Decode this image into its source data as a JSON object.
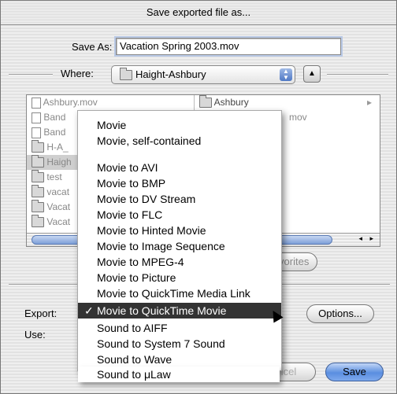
{
  "dialog": {
    "title": "Save exported file as...",
    "save_as_label": "Save As:",
    "save_as_value": "Vacation Spring 2003.mov",
    "where_label": "Where:",
    "where_value": "Haight-Ashbury"
  },
  "browser": {
    "left_column": [
      "Ashbury.mov",
      "Band",
      "Band",
      "H-A_",
      "Haigh",
      "test",
      "vacat",
      "Vacat",
      "Vacat"
    ],
    "left_selected_index": 4,
    "right_column": [
      "Ashbury",
      "mov"
    ],
    "add_to_favorites": "Add to Favorites"
  },
  "footer": {
    "export_label": "Export:",
    "use_label": "Use:",
    "options_button": "Options...",
    "cancel_button": "Cancel",
    "save_button": "Save"
  },
  "export_menu": {
    "items": [
      "Movie",
      "Movie, self-contained",
      "Movie to AVI",
      "Movie to BMP",
      "Movie to DV Stream",
      "Movie to FLC",
      "Movie to Hinted Movie",
      "Movie to Image Sequence",
      "Movie to MPEG-4",
      "Movie to Picture",
      "Movie to QuickTime Media Link",
      "Movie to QuickTime Movie",
      "Sound to AIFF",
      "Sound to System 7 Sound",
      "Sound to Wave",
      "Sound to μLaw"
    ],
    "selected_index": 11,
    "check_mark": "✓"
  },
  "colors": {
    "highlight_bg": "#333333",
    "default_button": "#5a8ee0"
  }
}
